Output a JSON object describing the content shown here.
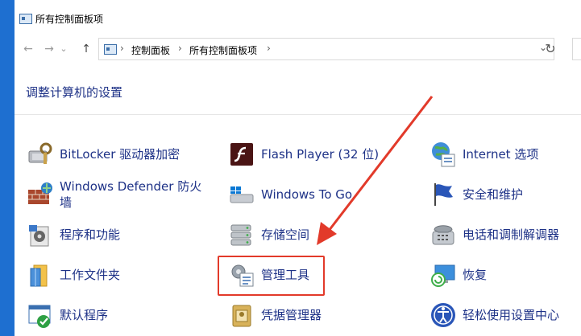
{
  "window": {
    "title": "所有控制面板项"
  },
  "nav": {
    "back_icon": "←",
    "forward_icon": "→",
    "history_icon": "⌄",
    "up_icon": "↑",
    "breadcrumb_sep1": "›",
    "breadcrumb_item1": "控制面板",
    "breadcrumb_sep2": "›",
    "breadcrumb_item2": "所有控制面板项",
    "breadcrumb_sep3": "›",
    "dropdown_icon": "⌄",
    "refresh_icon": "↻"
  },
  "main": {
    "heading": "调整计算机的设置",
    "items": [
      {
        "label": "BitLocker 驱动器加密",
        "icon": "bitlocker-icon"
      },
      {
        "label": "Flash Player (32 位)",
        "icon": "flash-player-icon"
      },
      {
        "label": "Internet 选项",
        "icon": "internet-options-icon"
      },
      {
        "label": "Windows Defender 防火墙",
        "icon": "firewall-icon"
      },
      {
        "label": "Windows To Go",
        "icon": "windows-to-go-icon"
      },
      {
        "label": "安全和维护",
        "icon": "security-maintenance-icon"
      },
      {
        "label": "程序和功能",
        "icon": "programs-features-icon"
      },
      {
        "label": "存储空间",
        "icon": "storage-spaces-icon"
      },
      {
        "label": "电话和调制解调器",
        "icon": "phone-modem-icon"
      },
      {
        "label": "工作文件夹",
        "icon": "work-folders-icon"
      },
      {
        "label": "管理工具",
        "icon": "admin-tools-icon"
      },
      {
        "label": "恢复",
        "icon": "recovery-icon"
      },
      {
        "label": "默认程序",
        "icon": "default-programs-icon"
      },
      {
        "label": "凭据管理器",
        "icon": "credential-manager-icon"
      },
      {
        "label": "轻松使用设置中心",
        "icon": "ease-of-access-icon"
      }
    ]
  },
  "annotation": {
    "highlight_color": "#e23a2a"
  }
}
